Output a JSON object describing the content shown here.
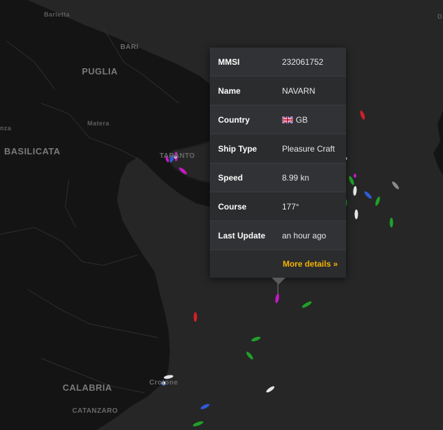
{
  "places": {
    "barletta": "Barletta",
    "bari": "BARI",
    "puglia": "PUGLIA",
    "matera": "Matera",
    "nza": "nza",
    "basilicata": "BASILICATA",
    "taranto": "TARANTO",
    "crotone": "Crotone",
    "calabria": "CALABRIA",
    "catanzaro": "CATANZARO",
    "corner": "D"
  },
  "popup": {
    "close_label": "×",
    "rows": [
      {
        "label": "MMSI",
        "value": "232061752"
      },
      {
        "label": "Name",
        "value": "NAVARN"
      },
      {
        "label": "Country",
        "value": "GB"
      },
      {
        "label": "Ship Type",
        "value": "Pleasure Craft"
      },
      {
        "label": "Speed",
        "value": "8.99 kn"
      },
      {
        "label": "Course",
        "value": "177°"
      },
      {
        "label": "Last Update",
        "value": "an hour ago"
      }
    ],
    "more_details": "More details »",
    "country_flag_icon": "uk-flag-icon"
  },
  "colors": {
    "accent": "#f5b400",
    "land": "#141414",
    "sea": "#262626",
    "ship_green": "#1fa02a",
    "ship_red": "#d0202a",
    "ship_magenta": "#c419c4",
    "ship_blue": "#2e5cd6",
    "ship_white": "#e6e6e6",
    "ship_grey": "#8a8a8a"
  },
  "ships": [
    {
      "type": "green",
      "color": "#1fa02a"
    },
    {
      "type": "red",
      "color": "#d0202a"
    },
    {
      "type": "magenta",
      "color": "#c419c4"
    },
    {
      "type": "blue",
      "color": "#2e5cd6"
    },
    {
      "type": "white",
      "color": "#e6e6e6"
    },
    {
      "type": "grey",
      "color": "#8a8a8a"
    }
  ]
}
